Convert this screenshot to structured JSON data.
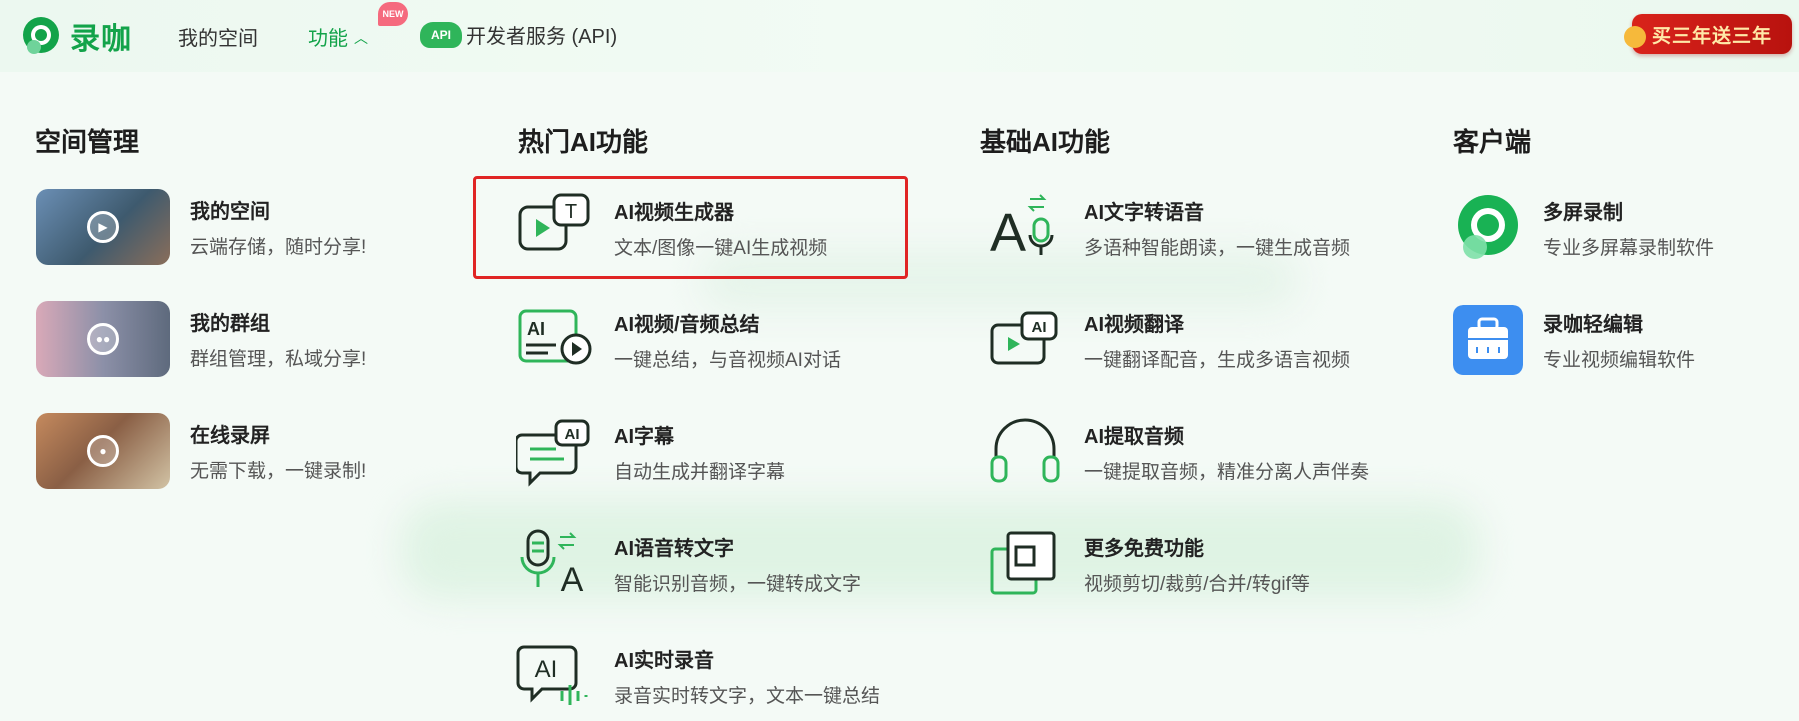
{
  "header": {
    "logo_text": "录咖",
    "nav": {
      "my_space": "我的空间",
      "features": "功能",
      "new_badge": "NEW",
      "api_badge": "API",
      "developer": "开发者服务 (API)"
    },
    "promo": "买三年送三年"
  },
  "columns": {
    "space": {
      "title": "空间管理",
      "items": [
        {
          "title": "我的空间",
          "desc": "云端存储，随时分享!"
        },
        {
          "title": "我的群组",
          "desc": "群组管理，私域分享!"
        },
        {
          "title": "在线录屏",
          "desc": "无需下载，一键录制!"
        }
      ]
    },
    "hot": {
      "title": "热门AI功能",
      "items": [
        {
          "title": "AI视频生成器",
          "desc": "文本/图像一键AI生成视频",
          "icon": "ai-video-generator-icon"
        },
        {
          "title": "AI视频/音频总结",
          "desc": "一键总结，与音视频AI对话",
          "icon": "ai-summary-icon"
        },
        {
          "title": "AI字幕",
          "desc": "自动生成并翻译字幕",
          "icon": "ai-subtitle-icon"
        },
        {
          "title": "AI语音转文字",
          "desc": "智能识别音频，一键转成文字",
          "icon": "speech-to-text-icon"
        },
        {
          "title": "AI实时录音",
          "desc": "录音实时转文字，文本一键总结",
          "icon": "realtime-recording-icon"
        }
      ]
    },
    "basic": {
      "title": "基础AI功能",
      "items": [
        {
          "title": "AI文字转语音",
          "desc": "多语种智能朗读，一键生成音频",
          "icon": "text-to-speech-icon"
        },
        {
          "title": "AI视频翻译",
          "desc": "一键翻译配音，生成多语言视频",
          "icon": "video-translate-icon"
        },
        {
          "title": "AI提取音频",
          "desc": "一键提取音频，精准分离人声伴奏",
          "icon": "headphones-icon"
        },
        {
          "title": "更多免费功能",
          "desc": "视频剪切/裁剪/合并/转gif等",
          "icon": "more-features-icon"
        }
      ]
    },
    "client": {
      "title": "客户端",
      "items": [
        {
          "title": "多屏录制",
          "desc": "专业多屏幕录制软件",
          "icon": "multi-screen-record-icon"
        },
        {
          "title": "录咖轻编辑",
          "desc": "专业视频编辑软件",
          "icon": "light-editor-icon"
        }
      ]
    }
  },
  "colors": {
    "brand_green": "#13a34a",
    "highlight_red": "#e02424",
    "editor_blue": "#3d8ef0"
  }
}
